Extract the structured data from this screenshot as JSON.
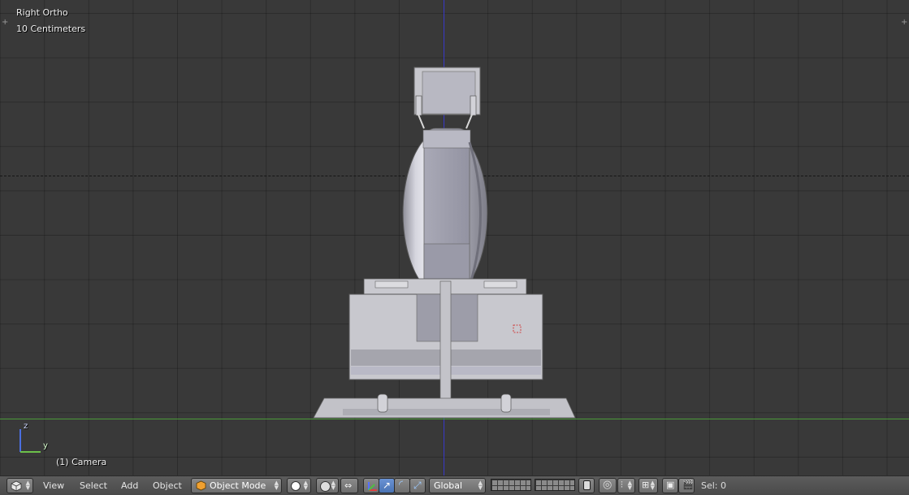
{
  "viewport": {
    "view_name": "Right Ortho",
    "scale_label": "10 Centimeters",
    "object_label": "(1) Camera",
    "axis_z": "z",
    "axis_y": "y"
  },
  "header": {
    "menus": [
      "View",
      "Select",
      "Add",
      "Object"
    ],
    "mode": "Object Mode",
    "transform_orientation": "Global",
    "status": "Sel: 0"
  },
  "colors": {
    "background": "#393939",
    "z_axis": "#3a3acb",
    "y_axis": "#4a9a3a",
    "active_button": "#5680c2"
  }
}
